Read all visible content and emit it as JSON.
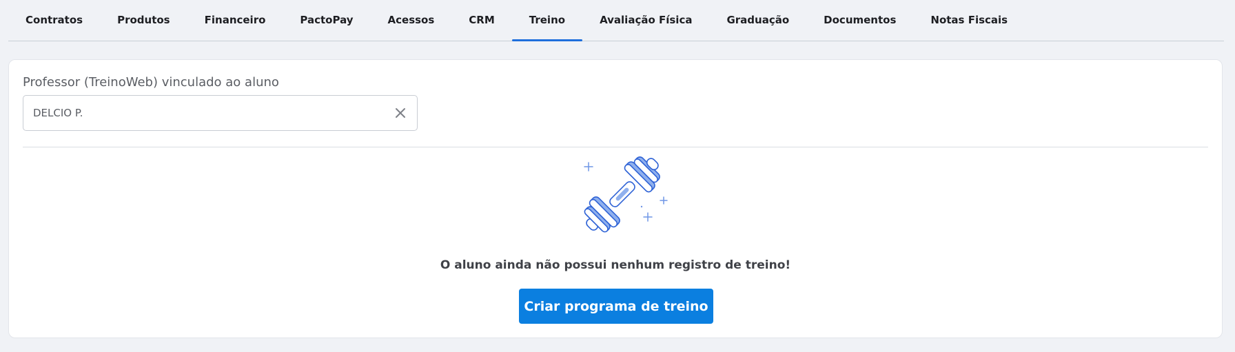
{
  "tabs": [
    {
      "label": "Contratos",
      "active": false
    },
    {
      "label": "Produtos",
      "active": false
    },
    {
      "label": "Financeiro",
      "active": false
    },
    {
      "label": "PactoPay",
      "active": false
    },
    {
      "label": "Acessos",
      "active": false
    },
    {
      "label": "CRM",
      "active": false
    },
    {
      "label": "Treino",
      "active": true
    },
    {
      "label": "Avaliação Física",
      "active": false
    },
    {
      "label": "Graduação",
      "active": false
    },
    {
      "label": "Documentos",
      "active": false
    },
    {
      "label": "Notas Fiscais",
      "active": false
    }
  ],
  "professor": {
    "label": "Professor (TreinoWeb) vinculado ao aluno",
    "value": "DELCIO P.",
    "clear_icon": "close-icon"
  },
  "empty_state": {
    "illustration": "dumbbell-icon",
    "message": "O aluno ainda não possui nenhum registro de treino!",
    "button_label": "Criar programa de treino"
  },
  "colors": {
    "accent": "#1e6fdc",
    "button": "#0b7fe0",
    "illustration_fill": "#8fb0ee",
    "illustration_stroke": "#2f63d6"
  }
}
